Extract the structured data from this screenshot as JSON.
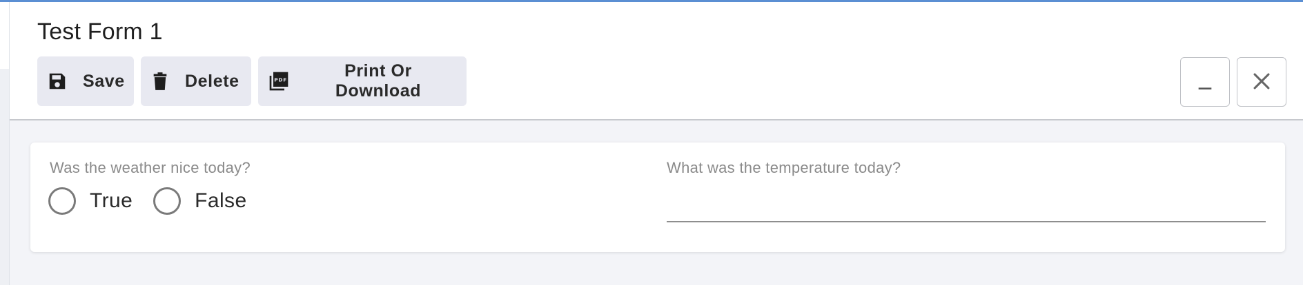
{
  "form": {
    "title": "Test Form 1"
  },
  "toolbar": {
    "save_label": "Save",
    "delete_label": "Delete",
    "print_label": "Print Or Download",
    "save_icon": "floppy-disk-icon",
    "delete_icon": "trash-icon",
    "print_icon": "pdf-icon"
  },
  "window_controls": {
    "minimize_icon": "minimize-icon",
    "close_icon": "close-icon"
  },
  "questions": {
    "weather": {
      "label": "Was the weather nice today?",
      "options": [
        "True",
        "False"
      ],
      "selected": null
    },
    "temperature": {
      "label": "What was the temperature today?",
      "value": "",
      "placeholder": ""
    }
  },
  "colors": {
    "accent": "#5b8fd3",
    "button_bg": "#e8e9f1",
    "page_bg": "#f3f4f8"
  }
}
